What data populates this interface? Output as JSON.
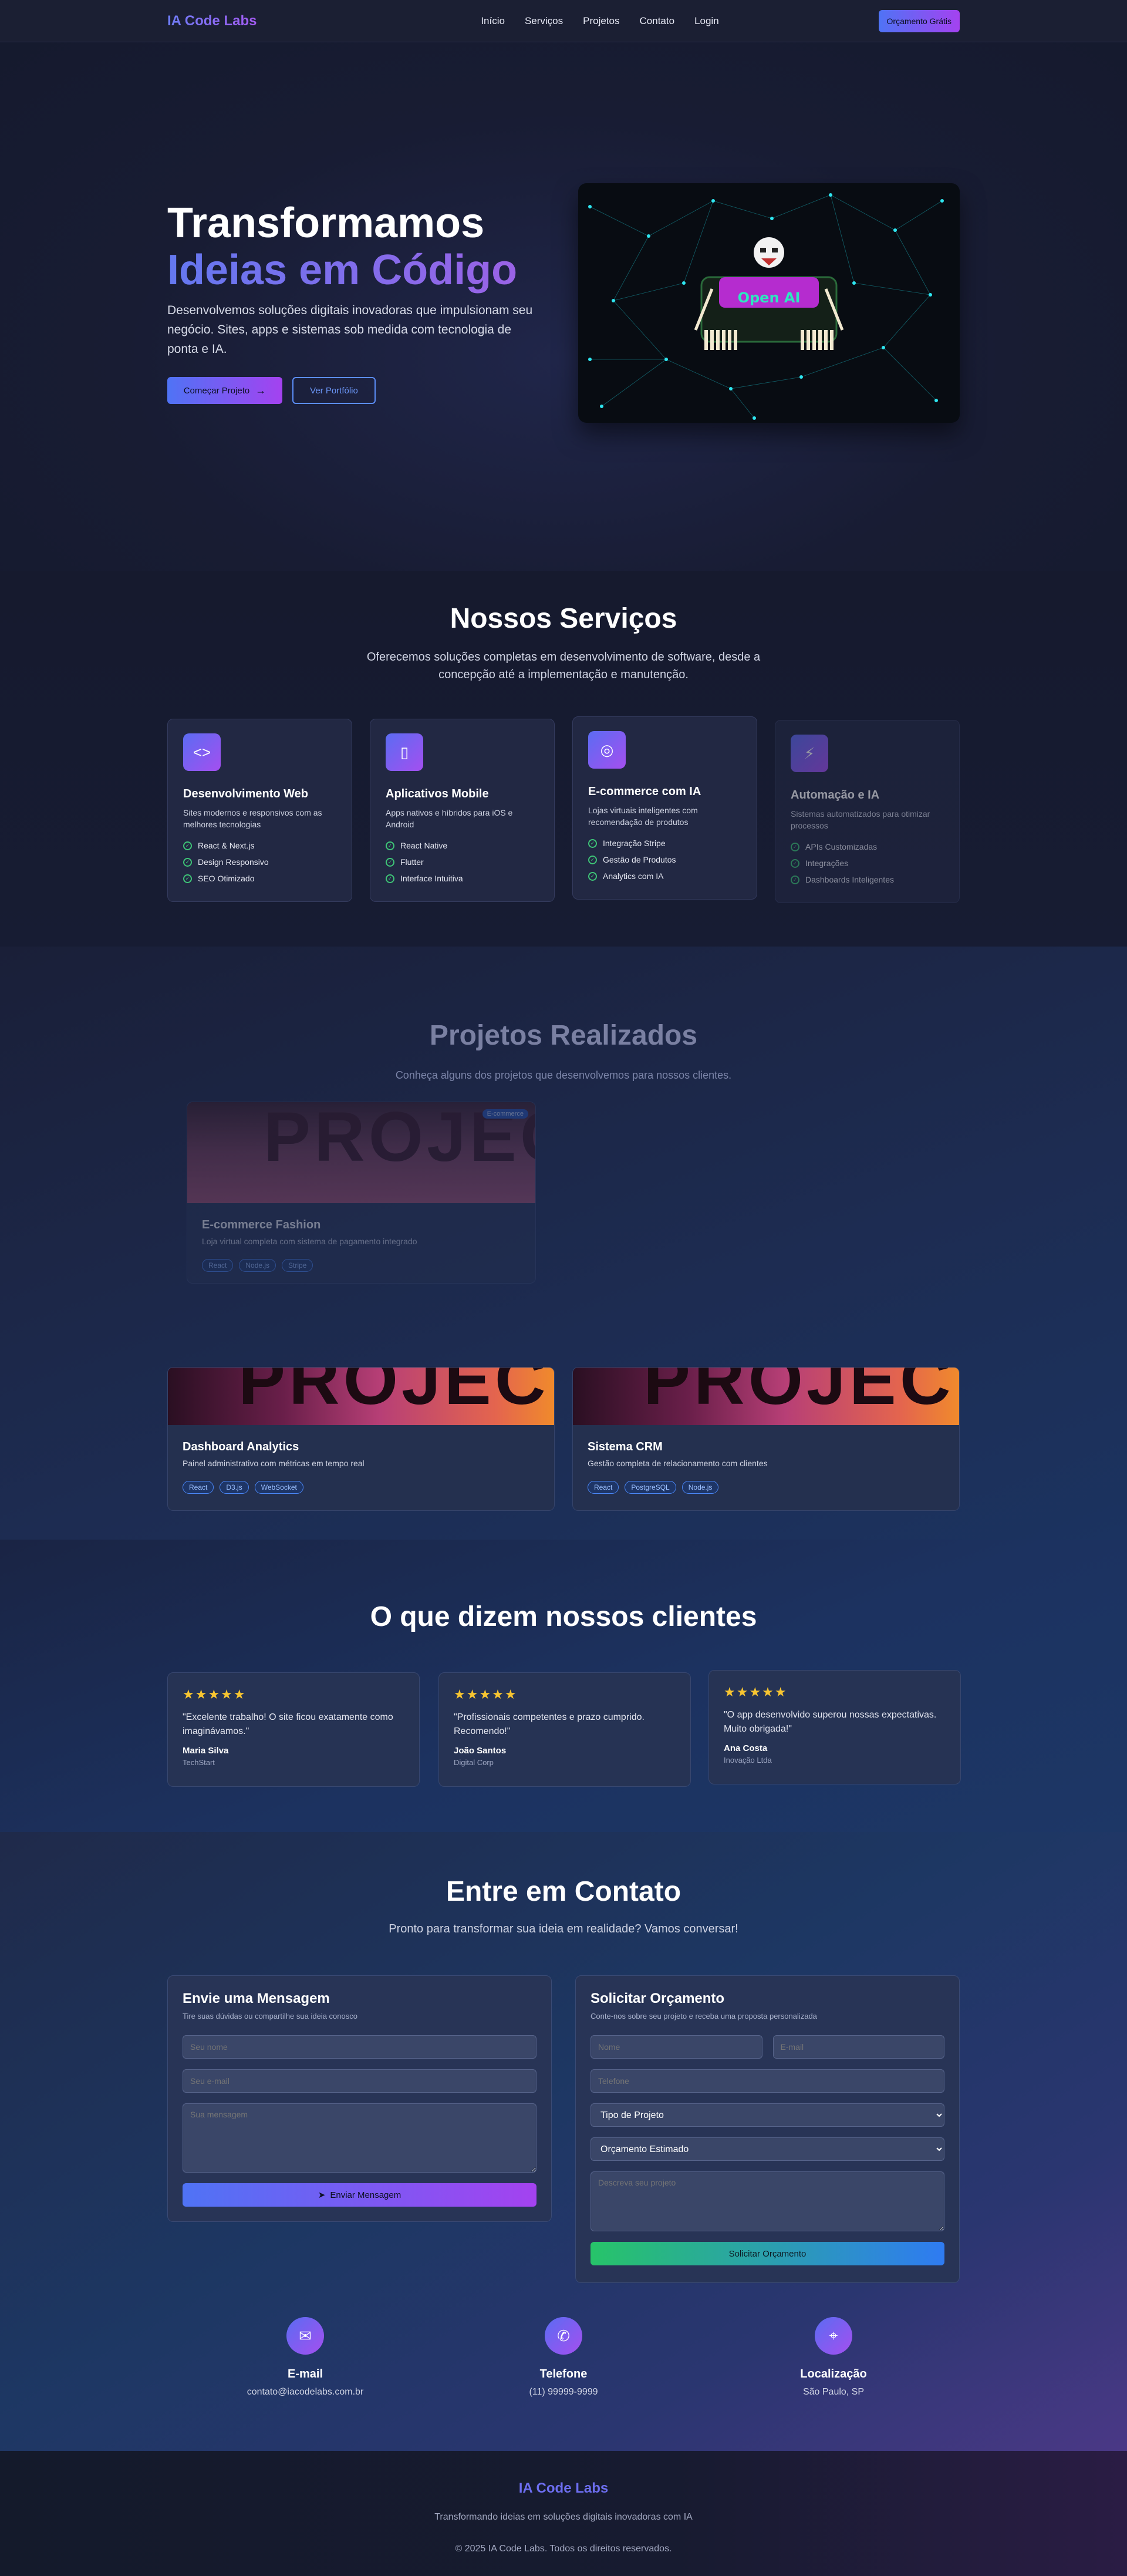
{
  "nav": {
    "logo": "IA Code Labs",
    "menu": [
      "Início",
      "Serviços",
      "Projetos",
      "Contato",
      "Login"
    ],
    "cta": "Orçamento Grátis"
  },
  "hero": {
    "title_line1": "Transformamos",
    "title_line2": "Ideias em Código",
    "description": "Desenvolvemos soluções digitais inovadoras que impulsionam seu negócio. Sites, apps e sistemas sob medida com tecnologia de ponta e IA.",
    "primary_button": "Começar Projeto",
    "secondary_button": "Ver Portfólio",
    "image_label": "Open AI"
  },
  "services": {
    "title": "Nossos Serviços",
    "subtitle": "Oferecemos soluções completas em desenvolvimento de software, desde a concepção até a implementação e manutenção.",
    "cards": [
      {
        "icon": "code-icon",
        "title": "Desenvolvimento Web",
        "desc": "Sites modernos e responsivos com as melhores tecnologias",
        "features": [
          "React & Next.js",
          "Design Responsivo",
          "SEO Otimizado"
        ]
      },
      {
        "icon": "smartphone-icon",
        "title": "Aplicativos Mobile",
        "desc": "Apps nativos e híbridos para iOS e Android",
        "features": [
          "React Native",
          "Flutter",
          "Interface Intuitiva"
        ]
      },
      {
        "icon": "globe-icon",
        "title": "E-commerce com IA",
        "desc": "Lojas virtuais inteligentes com recomendação de produtos",
        "features": [
          "Integração Stripe",
          "Gestão de Produtos",
          "Analytics com IA"
        ]
      },
      {
        "icon": "lightning-icon",
        "title": "Automação e IA",
        "desc": "Sistemas automatizados para otimizar processos",
        "features": [
          "APIs Customizadas",
          "Integrações",
          "Dashboards Inteligentes"
        ]
      }
    ]
  },
  "projects": {
    "title": "Projetos Realizados",
    "subtitle": "Conheça alguns dos projetos que desenvolvemos para nossos clientes.",
    "image_text": "PROJECTS",
    "items": [
      {
        "title": "E-commerce Fashion",
        "desc": "Loja virtual completa com sistema de pagamento integrado",
        "tags": [
          "React",
          "Node.js",
          "Stripe"
        ],
        "badge": "E-commerce"
      },
      {
        "title": "Dashboard Analytics",
        "desc": "Painel administrativo com métricas em tempo real",
        "tags": [
          "React",
          "D3.js",
          "WebSocket"
        ]
      },
      {
        "title": "Sistema CRM",
        "desc": "Gestão completa de relacionamento com clientes",
        "tags": [
          "React",
          "PostgreSQL",
          "Node.js"
        ]
      }
    ]
  },
  "testimonials": {
    "title": "O que dizem nossos clientes",
    "stars": "★★★★★",
    "items": [
      {
        "quote": "\"Excelente trabalho! O site ficou exatamente como imaginávamos.\"",
        "name": "Maria Silva",
        "role": "TechStart"
      },
      {
        "quote": "\"Profissionais competentes e prazo cumprido. Recomendo!\"",
        "name": "João Santos",
        "role": "Digital Corp"
      },
      {
        "quote": "\"O app desenvolvido superou nossas expectativas. Muito obrigada!\"",
        "name": "Ana Costa",
        "role": "Inovação Ltda"
      }
    ]
  },
  "contact": {
    "title": "Entre em Contato",
    "subtitle": "Pronto para transformar sua ideia em realidade? Vamos conversar!",
    "message_form": {
      "title": "Envie uma Mensagem",
      "subtitle": "Tire suas dúvidas ou compartilhe sua ideia conosco",
      "name_ph": "Seu nome",
      "email_ph": "Seu e-mail",
      "message_ph": "Sua mensagem",
      "submit": "Enviar Mensagem"
    },
    "quote_form": {
      "title": "Solicitar Orçamento",
      "subtitle": "Conte-nos sobre seu projeto e receba uma proposta personalizada",
      "name_ph": "Nome",
      "email_ph": "E-mail",
      "phone_ph": "Telefone",
      "project_type": "Tipo de Projeto",
      "budget": "Orçamento Estimado",
      "desc_ph": "Descreva seu projeto",
      "submit": "Solicitar Orçamento"
    },
    "info": [
      {
        "icon": "mail-icon",
        "label": "E-mail",
        "value": "contato@iacodelabs.com.br"
      },
      {
        "icon": "phone-icon",
        "label": "Telefone",
        "value": "(11) 99999-9999"
      },
      {
        "icon": "location-pin-icon",
        "label": "Localização",
        "value": "São Paulo, SP"
      }
    ]
  },
  "footer": {
    "logo": "IA Code Labs",
    "tagline": "Transformando ideias em soluções digitais inovadoras com IA",
    "copyright": "© 2025 IA Code Labs. Todos os direitos reservados."
  }
}
